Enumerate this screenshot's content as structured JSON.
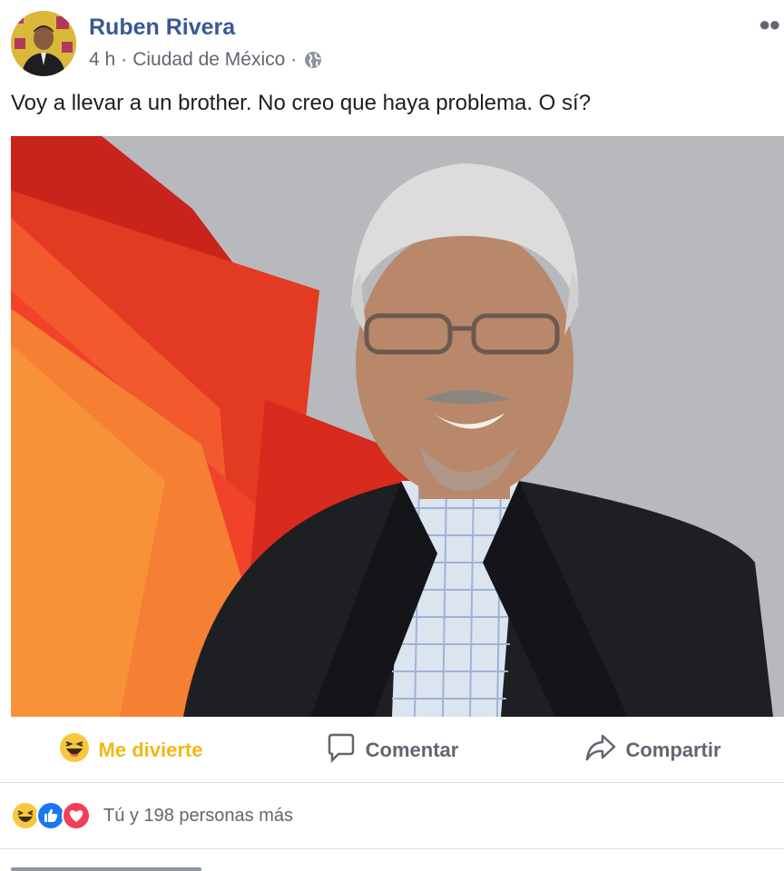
{
  "post": {
    "author": "Ruben Rivera",
    "time": "4 h",
    "location": "Ciudad de México",
    "text": "Voy a llevar a un brother. No creo que haya problema. O sí?"
  },
  "actions": {
    "reaction_label": "Me divierte",
    "comment_label": "Comentar",
    "share_label": "Compartir"
  },
  "reactions": {
    "summary": "Tú y 198 personas más",
    "icons": [
      "haha-icon",
      "like-icon",
      "love-icon"
    ]
  },
  "colors": {
    "author": "#385898",
    "haha_active": "#f0ba15",
    "like": "#1877f2",
    "love": "#f33e58",
    "muted": "#606770"
  }
}
